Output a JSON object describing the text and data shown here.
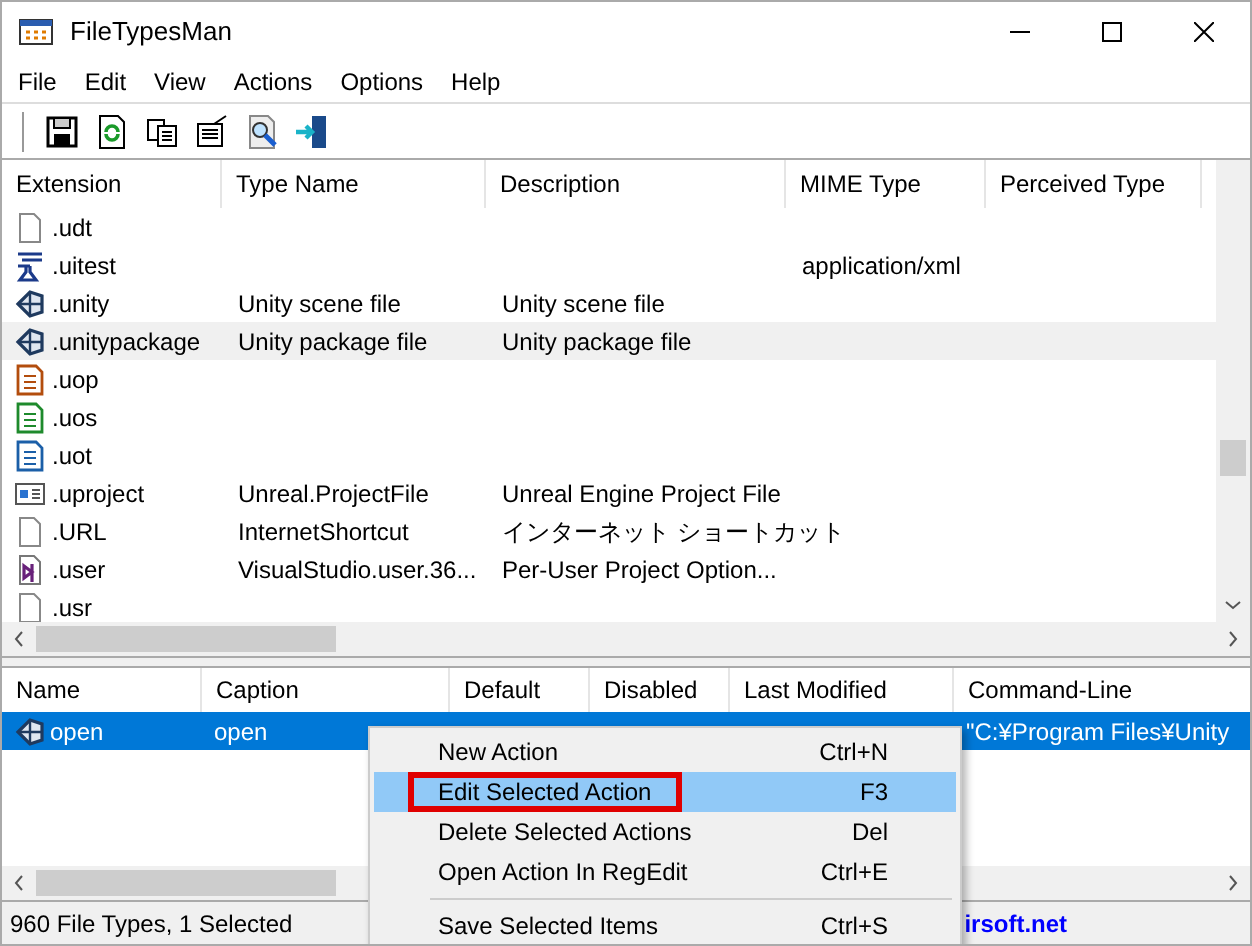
{
  "window": {
    "title": "FileTypesMan"
  },
  "menu": [
    "File",
    "Edit",
    "View",
    "Actions",
    "Options",
    "Help"
  ],
  "toolbar": [
    {
      "kind": "save"
    },
    {
      "kind": "refresh"
    },
    {
      "kind": "copy"
    },
    {
      "kind": "properties"
    },
    {
      "kind": "find"
    },
    {
      "kind": "exit"
    }
  ],
  "file_types": {
    "columns": [
      "Extension",
      "Type Name",
      "Description",
      "MIME Type",
      "Perceived Type"
    ],
    "rows": [
      {
        "kind": "blank",
        "cells": [
          ".udt",
          "",
          "",
          "",
          ""
        ],
        "selected": false
      },
      {
        "kind": "test",
        "cells": [
          ".uitest",
          "",
          "",
          "application/xml",
          ""
        ],
        "selected": false
      },
      {
        "kind": "unity",
        "cells": [
          ".unity",
          "Unity scene file",
          "Unity scene file",
          "",
          ""
        ],
        "selected": false
      },
      {
        "kind": "unity",
        "cells": [
          ".unitypackage",
          "Unity package file",
          "Unity package file",
          "",
          ""
        ],
        "selected": true
      },
      {
        "kind": "orange",
        "cells": [
          ".uop",
          "",
          "",
          "",
          ""
        ],
        "selected": false
      },
      {
        "kind": "green",
        "cells": [
          ".uos",
          "",
          "",
          "",
          ""
        ],
        "selected": false
      },
      {
        "kind": "blue",
        "cells": [
          ".uot",
          "",
          "",
          "",
          ""
        ],
        "selected": false
      },
      {
        "kind": "project",
        "cells": [
          ".uproject",
          "Unreal.ProjectFile",
          "Unreal Engine Project File",
          "",
          ""
        ],
        "selected": false
      },
      {
        "kind": "blank",
        "cells": [
          ".URL",
          "InternetShortcut",
          "インターネット ショートカット",
          "",
          ""
        ],
        "selected": false
      },
      {
        "kind": "vs",
        "cells": [
          ".user",
          "VisualStudio.user.36...",
          "Per-User Project Option...",
          "",
          ""
        ],
        "selected": false
      },
      {
        "kind": "blank",
        "cells": [
          ".usr",
          "",
          "",
          "",
          ""
        ],
        "selected": false
      }
    ]
  },
  "actions": {
    "columns": [
      "Name",
      "Caption",
      "Default",
      "Disabled",
      "Last Modified",
      "Command-Line"
    ],
    "rows": [
      {
        "kind": "unity",
        "cells": [
          "open",
          "open",
          "",
          "",
          "",
          "\"C:¥Program Files¥Unity"
        ],
        "selected": true
      }
    ]
  },
  "context_menu": [
    {
      "label": "New Action",
      "shortcut": "Ctrl+N",
      "selected": false
    },
    {
      "label": "Edit Selected Action",
      "shortcut": "F3",
      "selected": true,
      "boxed": true
    },
    {
      "label": "Delete Selected Actions",
      "shortcut": "Del",
      "selected": false
    },
    {
      "label": "Open Action In RegEdit",
      "shortcut": "Ctrl+E",
      "selected": false
    },
    {
      "kind": "separator"
    },
    {
      "label": "Save Selected Items",
      "shortcut": "Ctrl+S",
      "selected": false
    }
  ],
  "status_bar": {
    "text": "960 File Types, 1 Selected",
    "link": "irsoft.net"
  }
}
